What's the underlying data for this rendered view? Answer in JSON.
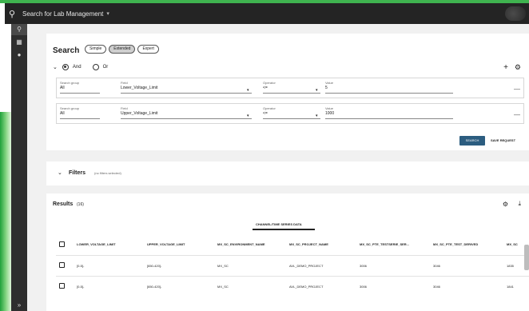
{
  "topbar": {
    "title": "Search for Lab Management",
    "caret": "▾"
  },
  "rail": {
    "icons": [
      "search-icon",
      "save-icon",
      "pin-icon"
    ]
  },
  "search": {
    "heading": "Search",
    "modes": [
      "Simple",
      "Extended",
      "Expert"
    ],
    "selected_mode": "Extended",
    "logic": {
      "and": "And",
      "or": "Or",
      "selected": "And"
    },
    "criteria": [
      {
        "group_label": "Search group",
        "group": "All",
        "field_label": "Field",
        "field": "Lower_Voltage_Limit",
        "operator_label": "Operator",
        "operator": "<=",
        "value_label": "Value",
        "value": "5"
      },
      {
        "group_label": "Search group",
        "group": "All",
        "field_label": "Field",
        "field": "Upper_Voltage_Limit",
        "operator_label": "Operator",
        "operator": "<=",
        "value_label": "Value",
        "value": "1000"
      }
    ],
    "search_button": "SEARCH",
    "save_button": "SAVE REQUEST"
  },
  "filters": {
    "title": "Filters",
    "subtitle": "(no filters selected)"
  },
  "results": {
    "title": "Results",
    "count": "(16)",
    "tab": "CHANNEL/TIME SERIES DATA",
    "columns": [
      "LOWER_VOLTAGE_LIMIT",
      "UPPER_VOLTAGE_LIMIT",
      "MX_SC_ENVIRONMENT_NAME",
      "MX_SC_PROJECT_NAME",
      "MX_SC_PTE_TESTSERIE_SER...",
      "MX_SC_PTE_TEST_DERIVED",
      "MX_SC"
    ],
    "rows": [
      [
        "[0-5]-",
        "[650-420]-",
        "MX_SC",
        "AVL_DEMO_PROJECT",
        "3006",
        "3046",
        "1835"
      ],
      [
        "[0-5]-",
        "[650-420]-",
        "MX_SC",
        "AVL_DEMO_PROJECT",
        "3006",
        "3046",
        "1841"
      ]
    ]
  }
}
